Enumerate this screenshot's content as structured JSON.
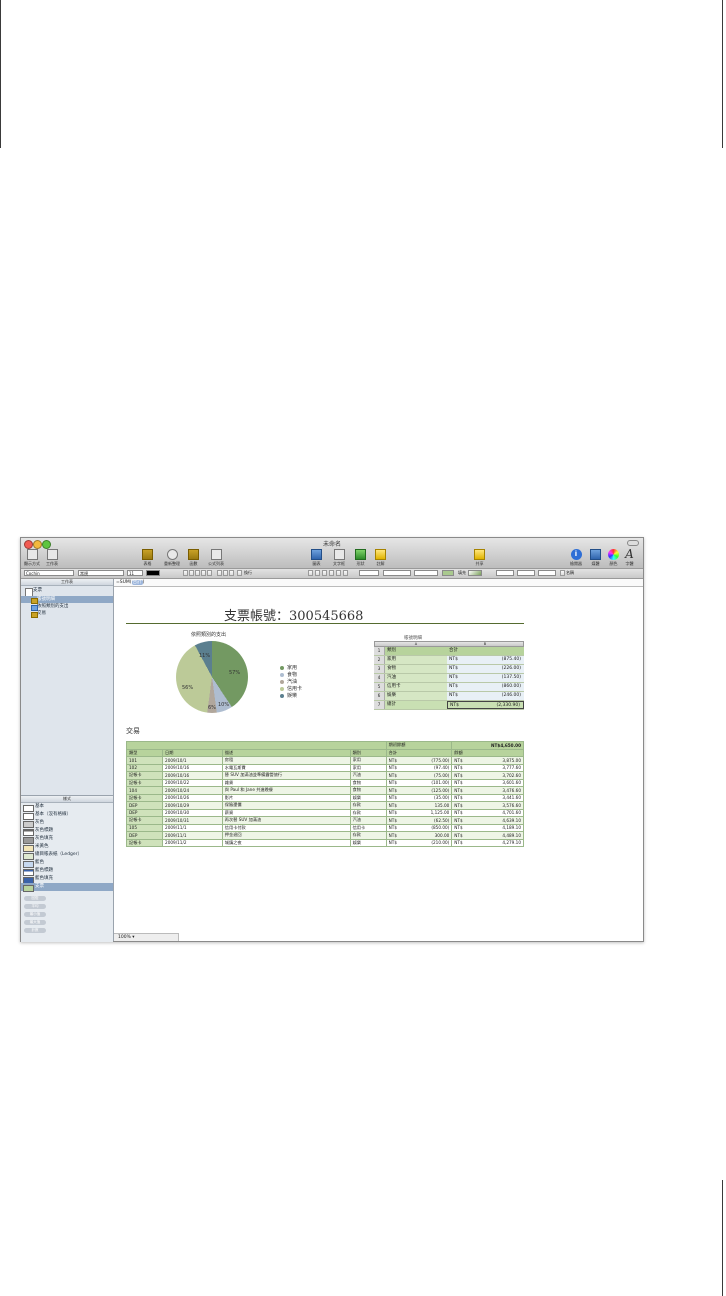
{
  "window": {
    "title": "未命名"
  },
  "toolbar": {
    "left": [
      {
        "label": "顯示方式",
        "icon": "view-icon"
      },
      {
        "label": "工作表",
        "icon": "sheet-icon"
      }
    ],
    "mid1": [
      {
        "label": "表格",
        "icon": "table-icon"
      },
      {
        "label": "重新整理",
        "icon": "reorganize-icon"
      },
      {
        "label": "函數",
        "icon": "function-icon"
      },
      {
        "label": "公式列表",
        "icon": "formula-list-icon"
      }
    ],
    "mid2": [
      {
        "label": "圖表",
        "icon": "chart-icon"
      },
      {
        "label": "文字框",
        "icon": "textbox-icon"
      },
      {
        "label": "形狀",
        "icon": "shape-icon"
      },
      {
        "label": "註解",
        "icon": "comment-icon"
      }
    ],
    "share": {
      "label": "共享",
      "icon": "share-icon"
    },
    "right": [
      {
        "label": "檢閱器",
        "icon": "inspector-icon"
      },
      {
        "label": "媒體",
        "icon": "media-icon"
      },
      {
        "label": "顏色",
        "icon": "colors-icon"
      },
      {
        "label": "字體",
        "icon": "fonts-icon"
      }
    ]
  },
  "format_bar": {
    "font": "Cochin",
    "weight": "常規",
    "size": "11",
    "wrap_label": "換行",
    "fill_label": "填充",
    "name_label": "名稱"
  },
  "sidebar": {
    "header": "工作表",
    "doc": "支票",
    "items": [
      "帳號明細",
      "依照類別的支出",
      "交易"
    ],
    "styles_header": "樣式",
    "styles": [
      "基本",
      "基本（沒有格線）",
      "灰色",
      "灰色標題",
      "灰色填充",
      "米黃色",
      "總目帳表紙（Ledger）",
      "藍色",
      "藍色標題",
      "藍色填充",
      "支票"
    ],
    "pills": [
      "回復",
      "平均",
      "最小值",
      "最大值",
      "計數"
    ]
  },
  "canvas": {
    "formula": "=SUM(",
    "formula_token": "合計",
    "title": "支票帳號：300545668",
    "chart_title": "依照類別的支出",
    "zoom": "100%"
  },
  "chart_data": {
    "type": "pie",
    "title": "依照類別的支出",
    "categories": [
      "家用",
      "食物",
      "汽油",
      "信用卡",
      "娛樂"
    ],
    "values": [
      57,
      10,
      6,
      56,
      11
    ],
    "labels": [
      "57%",
      "10%",
      "6%",
      "56%",
      "11%"
    ],
    "colors": [
      "#739962",
      "#aebdd0",
      "#b1a79c",
      "#bcca98",
      "#5b7f8f"
    ]
  },
  "summary_table": {
    "overlay_title": "帳號明細",
    "cols": [
      "A",
      "B"
    ],
    "head": {
      "a": "類別",
      "b": "合計"
    },
    "rows": [
      {
        "n": "2",
        "a": "家用",
        "cur": "NT$",
        "v": "(875.40)"
      },
      {
        "n": "3",
        "a": "食物",
        "cur": "NT$",
        "v": "(226.00)"
      },
      {
        "n": "4",
        "a": "汽油",
        "cur": "NT$",
        "v": "(137.50)"
      },
      {
        "n": "5",
        "a": "信用卡",
        "cur": "NT$",
        "v": "(860.00)"
      },
      {
        "n": "6",
        "a": "娛樂",
        "cur": "NT$",
        "v": "(246.00)"
      }
    ],
    "total": {
      "n": "7",
      "a": "總計",
      "cur": "NT$",
      "v": "(2,330.90)"
    }
  },
  "transactions": {
    "title": "交易",
    "balance_label": "期初餘額",
    "balance_value": "NT$4,650.00",
    "headers": [
      "類型",
      "日期",
      "描述",
      "類別",
      "合計",
      "餘額"
    ],
    "rows": [
      [
        "101",
        "2009/10/1",
        "房租",
        "家用",
        "NT$",
        "(775.00)",
        "NT$",
        "3,875.00"
      ],
      [
        "102",
        "2009/10/16",
        "水電瓦斯費",
        "家用",
        "NT$",
        "(97.40)",
        "NT$",
        "3,777.60"
      ],
      [
        "記帳卡",
        "2009/10/16",
        "替 SUV 加滿油並準備露營旅行",
        "汽油",
        "NT$",
        "(75.00)",
        "NT$",
        "3,702.60"
      ],
      [
        "記帳卡",
        "2009/10/22",
        "雜貨",
        "食物",
        "NT$",
        "(101.00)",
        "NT$",
        "3,601.60"
      ],
      [
        "104",
        "2009/10/24",
        "與 Paul 和 Jane 共進晚餐",
        "食物",
        "NT$",
        "(125.00)",
        "NT$",
        "3,476.60"
      ],
      [
        "記帳卡",
        "2009/10/26",
        "影片",
        "娛樂",
        "NT$",
        "(35.00)",
        "NT$",
        "3,441.60"
      ],
      [
        "DEP",
        "2009/10/29",
        "保險還價",
        "存款",
        "NT$",
        "135.00",
        "NT$",
        "3,576.60"
      ],
      [
        "DEP",
        "2009/10/30",
        "薪資",
        "存款",
        "NT$",
        "1,125.00",
        "NT$",
        "4,701.60"
      ],
      [
        "記帳卡",
        "2009/10/31",
        "再次替 SUV 加滿油",
        "汽油",
        "NT$",
        "(62.50)",
        "NT$",
        "4,639.10"
      ],
      [
        "105",
        "2009/11/1",
        "信用卡付款",
        "信用卡",
        "NT$",
        "(850.00)",
        "NT$",
        "4,189.10"
      ],
      [
        "DEP",
        "2009/11/1",
        "押金退回",
        "存款",
        "NT$",
        "300.00",
        "NT$",
        "4,489.10"
      ],
      [
        "記帳卡",
        "2009/11/2",
        "城鎮之夜",
        "娛樂",
        "NT$",
        "(210.00)",
        "NT$",
        "4,279.10"
      ]
    ]
  }
}
